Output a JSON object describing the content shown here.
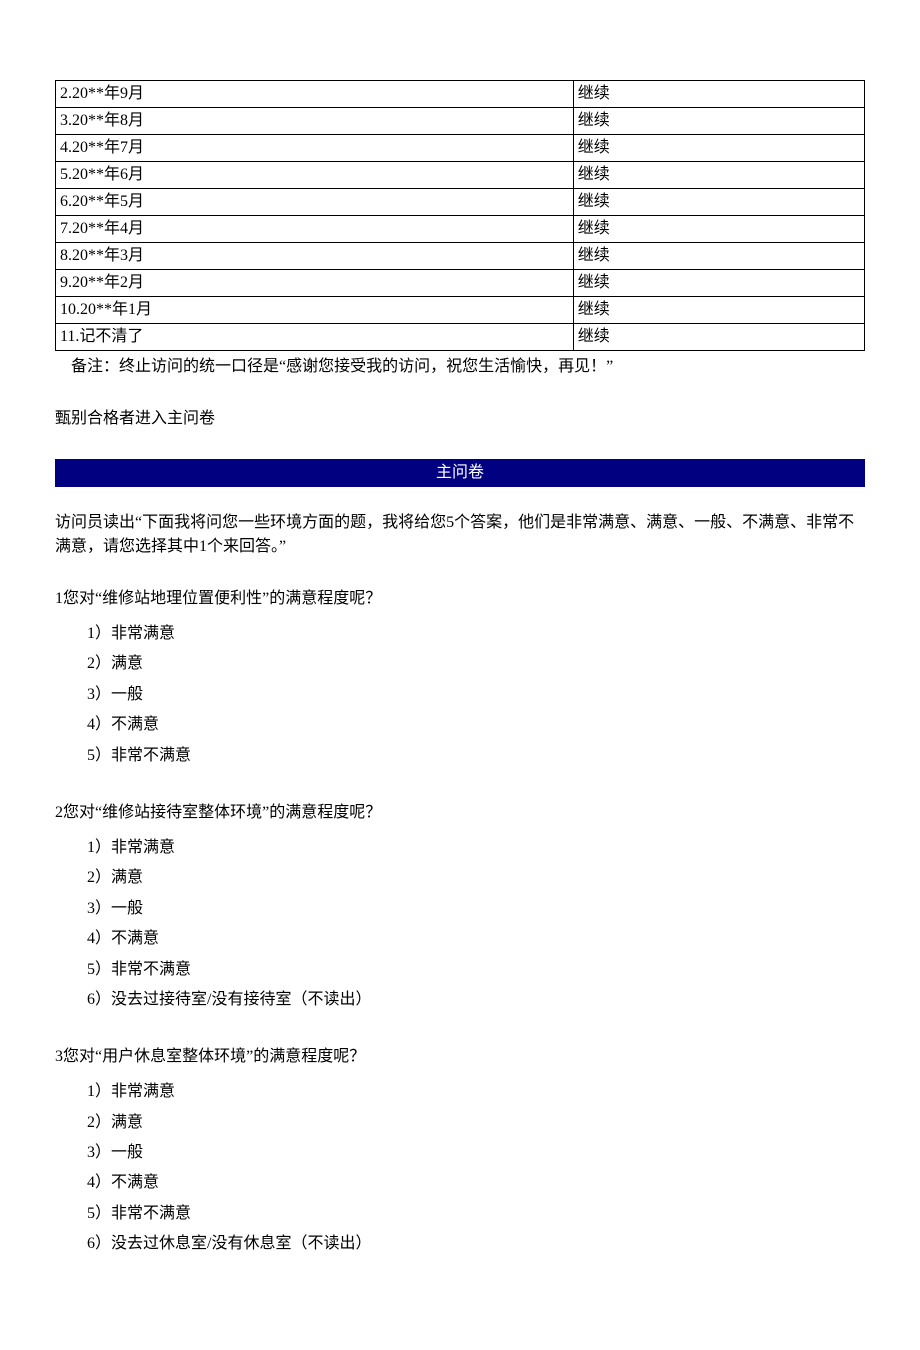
{
  "table_rows": [
    {
      "left": "2.20**年9月",
      "right": "继续"
    },
    {
      "left": "3.20**年8月",
      "right": "继续"
    },
    {
      "left": "4.20**年7月",
      "right": "继续"
    },
    {
      "left": "5.20**年6月",
      "right": "继续"
    },
    {
      "left": "6.20**年5月",
      "right": "继续"
    },
    {
      "left": "7.20**年4月",
      "right": "继续"
    },
    {
      "left": "8.20**年3月",
      "right": "继续"
    },
    {
      "left": "9.20**年2月",
      "right": "继续"
    },
    {
      "left": "10.20**年1月",
      "right": "继续"
    },
    {
      "left": "11.记不清了",
      "right": "继续"
    }
  ],
  "note_text": "备注：终止访问的统一口径是“感谢您接受我的访问，祝您生活愉快，再见！”",
  "eligible_text": "甄别合格者进入主问卷",
  "section_title": "主问卷",
  "instruction_text": "访问员读出“下面我将问您一些环境方面的题，我将给您5个答案，他们是非常满意、满意、一般、不满意、非常不满意，请您选择其中1个来回答。”",
  "questions": [
    {
      "text": "1您对“维修站地理位置便利性”的满意程度呢？",
      "options": [
        "1）非常满意",
        "2）满意",
        "3）一般",
        "4）不满意",
        "5）非常不满意"
      ]
    },
    {
      "text": "2您对“维修站接待室整体环境”的满意程度呢？",
      "options": [
        "1）非常满意",
        "2）满意",
        "3）一般",
        "4）不满意",
        "5）非常不满意",
        "6）没去过接待室/没有接待室（不读出）"
      ]
    },
    {
      "text": "3您对“用户休息室整体环境”的满意程度呢？",
      "options": [
        "1）非常满意",
        "2）满意",
        "3）一般",
        "4）不满意",
        "5）非常不满意",
        "6）没去过休息室/没有休息室（不读出）"
      ]
    }
  ]
}
